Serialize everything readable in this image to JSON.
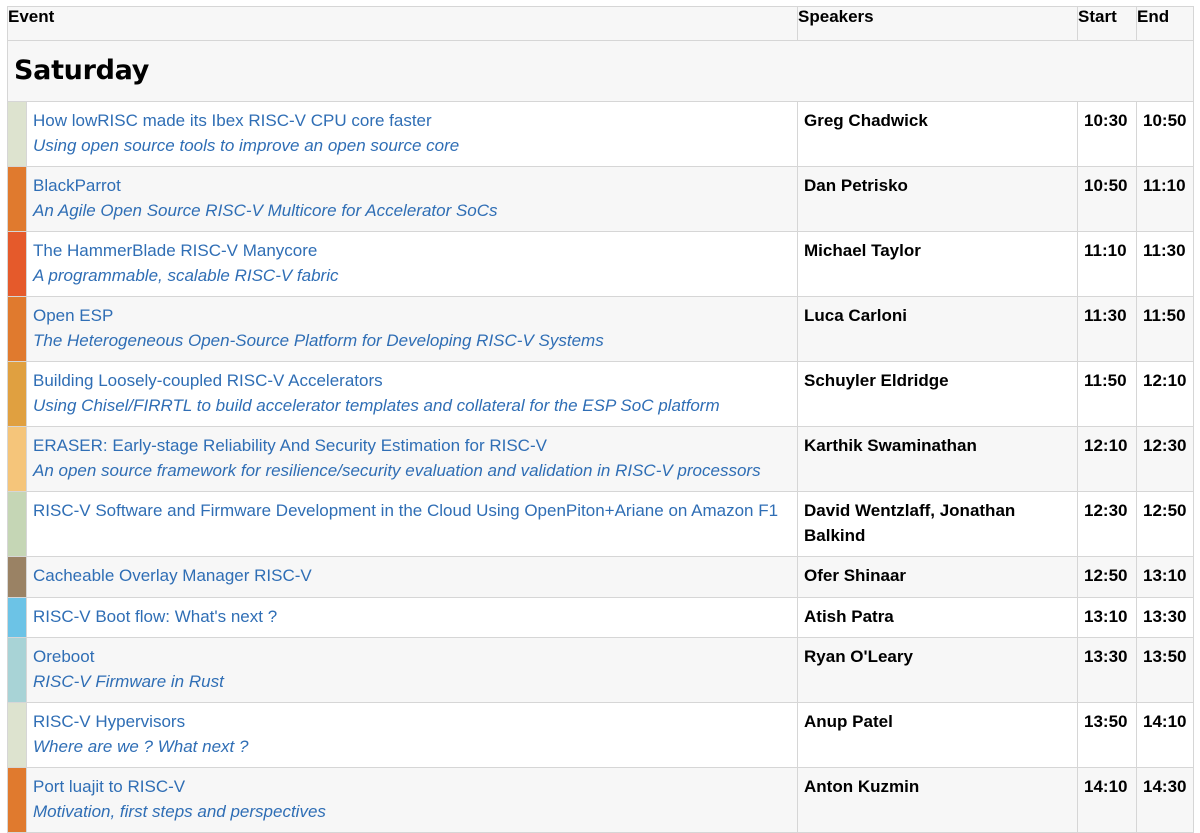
{
  "header": {
    "event": "Event",
    "speakers": "Speakers",
    "start": "Start",
    "end": "End"
  },
  "day": {
    "title": "Saturday"
  },
  "events": [
    {
      "title": "How lowRISC made its Ibex RISC-V CPU core faster",
      "subtitle": "Using open source tools to improve an open source core",
      "speakers": "Greg Chadwick",
      "start": "10:30",
      "end": "10:50",
      "color": "#dde3cf"
    },
    {
      "title": "BlackParrot",
      "subtitle": "An Agile Open Source RISC-V Multicore for Accelerator SoCs",
      "speakers": "Dan Petrisko",
      "start": "10:50",
      "end": "11:10",
      "color": "#e07a2e"
    },
    {
      "title": "The HammerBlade RISC-V Manycore",
      "subtitle": "A programmable, scalable RISC-V fabric",
      "speakers": "Michael Taylor",
      "start": "11:10",
      "end": "11:30",
      "color": "#e55a2b"
    },
    {
      "title": "Open ESP",
      "subtitle": "The Heterogeneous Open-Source Platform for Developing RISC-V Systems",
      "speakers": "Luca Carloni",
      "start": "11:30",
      "end": "11:50",
      "color": "#e07a2e"
    },
    {
      "title": "Building Loosely-coupled RISC-V Accelerators",
      "subtitle": "Using Chisel/FIRRTL to build accelerator templates and collateral for the ESP SoC platform",
      "speakers": "Schuyler Eldridge",
      "start": "11:50",
      "end": "12:10",
      "color": "#e0a040"
    },
    {
      "title": "ERASER: Early-stage Reliability And Security Estimation for RISC-V",
      "subtitle": "An open source framework for resilience/security evaluation and validation in RISC-V processors",
      "speakers": "Karthik Swaminathan",
      "start": "12:10",
      "end": "12:30",
      "color": "#f5c57a"
    },
    {
      "title": "RISC-V Software and Firmware Development in the Cloud Using OpenPiton+Ariane on Amazon F1",
      "subtitle": "",
      "speakers": "David Wentzlaff, Jonathan Balkind",
      "start": "12:30",
      "end": "12:50",
      "color": "#c5d6b5"
    },
    {
      "title": "Cacheable Overlay Manager RISC-V",
      "subtitle": "",
      "speakers": "Ofer Shinaar",
      "start": "12:50",
      "end": "13:10",
      "color": "#9a8264"
    },
    {
      "title": "RISC-V Boot flow: What's next ?",
      "subtitle": "",
      "speakers": "Atish Patra",
      "start": "13:10",
      "end": "13:30",
      "color": "#6cc3e6"
    },
    {
      "title": "Oreboot",
      "subtitle": "RISC-V Firmware in Rust",
      "speakers": "Ryan O'Leary",
      "start": "13:30",
      "end": "13:50",
      "color": "#a8d3d6"
    },
    {
      "title": "RISC-V Hypervisors",
      "subtitle": "Where are we ? What next ?",
      "speakers": "Anup Patel",
      "start": "13:50",
      "end": "14:10",
      "color": "#dde3cf"
    },
    {
      "title": "Port luajit to RISC-V",
      "subtitle": "Motivation, first steps and perspectives",
      "speakers": "Anton Kuzmin",
      "start": "14:10",
      "end": "14:30",
      "color": "#e07a2e"
    }
  ]
}
